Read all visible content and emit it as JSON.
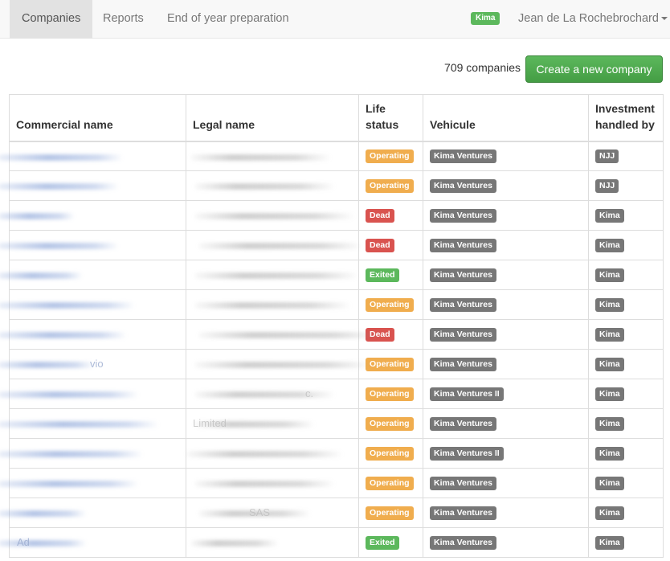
{
  "navbar": {
    "tabs": [
      {
        "label": "Companies",
        "active": true
      },
      {
        "label": "Reports",
        "active": false
      },
      {
        "label": "End of year preparation",
        "active": false
      }
    ],
    "org_badge": "Kima",
    "user_name": "Jean de La Rochebrochard"
  },
  "toolbar": {
    "count_text": "709 companies",
    "create_label": "Create a new company"
  },
  "table": {
    "headers": {
      "commercial_name": "Commercial name",
      "legal_name": "Legal name",
      "life_status": [
        "Life",
        "status"
      ],
      "vehicule": "Vehicule",
      "investment": [
        "Investment",
        "handled by"
      ]
    },
    "rows": [
      {
        "commercial_fragment": "",
        "legal_fragment": "",
        "status": "Operating",
        "vehicule": "Kima Ventures",
        "handled_by": "NJJ"
      },
      {
        "commercial_fragment": "",
        "legal_fragment": "",
        "status": "Operating",
        "vehicule": "Kima Ventures",
        "handled_by": "NJJ"
      },
      {
        "commercial_fragment": "",
        "legal_fragment": "",
        "status": "Dead",
        "vehicule": "Kima Ventures",
        "handled_by": "Kima"
      },
      {
        "commercial_fragment": "",
        "legal_fragment": "",
        "status": "Dead",
        "vehicule": "Kima Ventures",
        "handled_by": "Kima"
      },
      {
        "commercial_fragment": "",
        "legal_fragment": "",
        "status": "Exited",
        "vehicule": "Kima Ventures",
        "handled_by": "Kima"
      },
      {
        "commercial_fragment": "",
        "legal_fragment": "",
        "status": "Operating",
        "vehicule": "Kima Ventures",
        "handled_by": "Kima"
      },
      {
        "commercial_fragment": "",
        "legal_fragment": "",
        "status": "Dead",
        "vehicule": "Kima Ventures",
        "handled_by": "Kima"
      },
      {
        "commercial_fragment": "vio",
        "legal_fragment": "",
        "status": "Operating",
        "vehicule": "Kima Ventures",
        "handled_by": "Kima"
      },
      {
        "commercial_fragment": "",
        "legal_fragment": "c.",
        "status": "Operating",
        "vehicule": "Kima Ventures II",
        "handled_by": "Kima"
      },
      {
        "commercial_fragment": "",
        "legal_fragment": "Limited",
        "status": "Operating",
        "vehicule": "Kima Ventures",
        "handled_by": "Kima"
      },
      {
        "commercial_fragment": "",
        "legal_fragment": "",
        "status": "Operating",
        "vehicule": "Kima Ventures II",
        "handled_by": "Kima"
      },
      {
        "commercial_fragment": "",
        "legal_fragment": "",
        "status": "Operating",
        "vehicule": "Kima Ventures",
        "handled_by": "Kima"
      },
      {
        "commercial_fragment": "",
        "legal_fragment": "SAS",
        "status": "Operating",
        "vehicule": "Kima Ventures",
        "handled_by": "Kima"
      },
      {
        "commercial_fragment": "Ad",
        "legal_fragment": "",
        "status": "Exited",
        "vehicule": "Kima Ventures",
        "handled_by": "Kima"
      }
    ]
  },
  "colors": {
    "operating": "#f0ad4e",
    "dead": "#d9534f",
    "exited": "#5cb85c",
    "neutral_label": "#777777",
    "primary_button": "#5cb85c"
  }
}
